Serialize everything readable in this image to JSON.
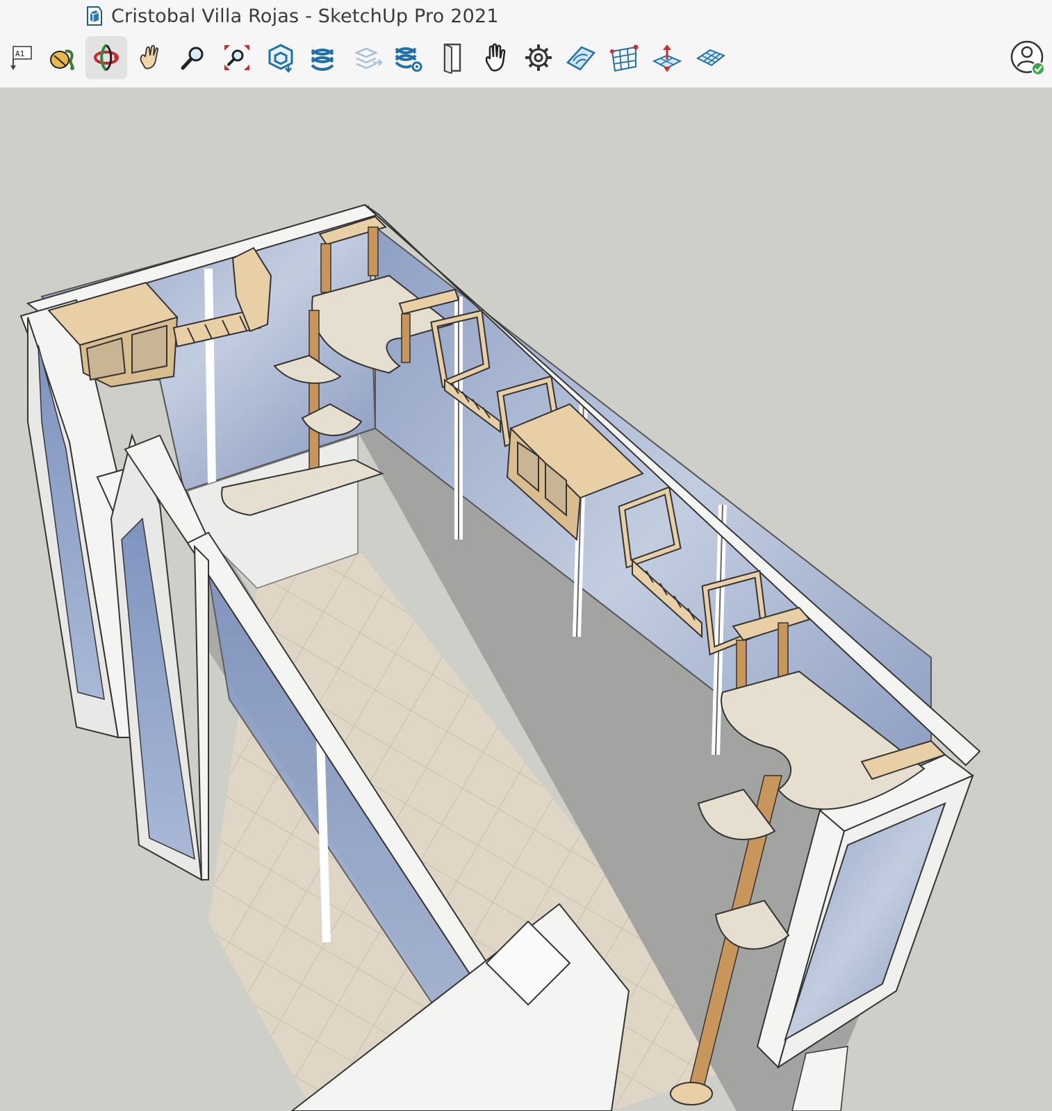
{
  "window": {
    "title": "Cristobal Villa Rojas - SketchUp Pro 2021",
    "app_icon": "sketchup-logo-icon"
  },
  "toolbar": {
    "tools": [
      {
        "name": "text-label-icon",
        "label": "A1",
        "active": false
      },
      {
        "name": "paint-bucket-icon",
        "active": false
      },
      {
        "name": "orbit-icon",
        "active": true
      },
      {
        "name": "pan-hand-icon",
        "active": false
      },
      {
        "name": "zoom-icon",
        "active": false
      },
      {
        "name": "zoom-extents-icon",
        "active": false
      },
      {
        "name": "model-info-icon",
        "active": false
      },
      {
        "name": "layers-icon",
        "active": false
      },
      {
        "name": "layers-disabled-icon",
        "active": false
      },
      {
        "name": "layer-settings-icon",
        "active": false
      },
      {
        "name": "door-icon",
        "active": false
      },
      {
        "name": "hand-stop-icon",
        "active": false
      },
      {
        "name": "settings-gear-icon",
        "active": false
      },
      {
        "name": "sandbox-contour-icon",
        "active": false
      },
      {
        "name": "sandbox-grid-icon",
        "active": false
      },
      {
        "name": "smoove-icon",
        "active": false
      },
      {
        "name": "drape-mesh-icon",
        "active": false
      }
    ],
    "account_icon": "user-account-icon",
    "account_status": "signed-in-check-icon"
  },
  "colors": {
    "background": "#cfcfca",
    "wall": "#f4f4f2",
    "glass": "#93a3c4",
    "floor": "#dcd3c4",
    "wood": "#e8cfa6",
    "post": "#c8955a",
    "carpet": "#e6dfd0"
  }
}
